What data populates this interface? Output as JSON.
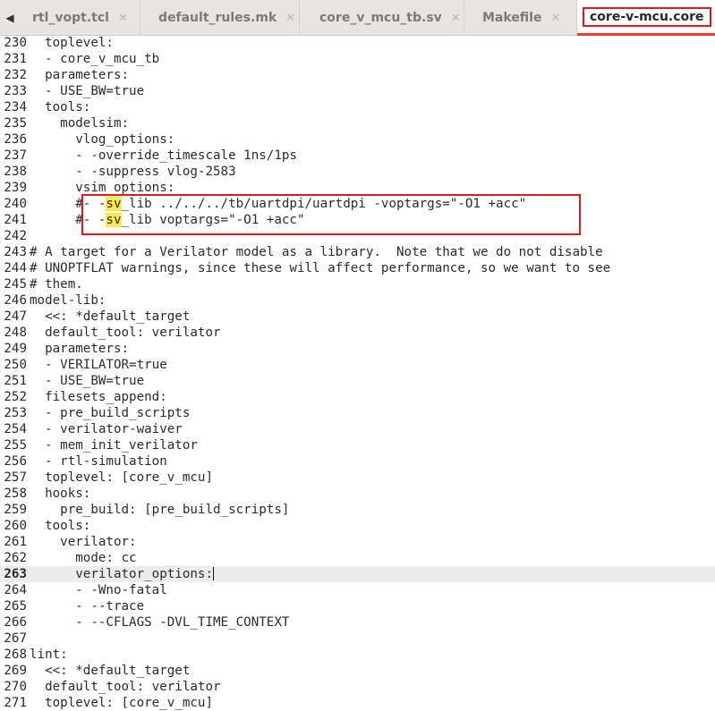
{
  "tabs": [
    {
      "label": "rtl_vopt.tcl",
      "active": false
    },
    {
      "label": "default_rules.mk",
      "active": false
    },
    {
      "label": "core_v_mcu_tb.sv",
      "active": false
    },
    {
      "label": "Makefile",
      "active": false
    },
    {
      "label": "core-v-mcu.core",
      "active": true
    }
  ],
  "icons": {
    "scroll_left": "triangle-left-icon",
    "close": "close-x-icon"
  },
  "glyphs": {
    "scroll_left": "◀",
    "close": "✕"
  },
  "colors": {
    "highlight": "#fce94f",
    "annotation": "#e0191b",
    "active_tab_underline": "#e8412c",
    "current_line": "#ececec"
  },
  "editor": {
    "current_line": 263,
    "lines": [
      {
        "num": "230",
        "pre": "  toplevel:"
      },
      {
        "num": "231",
        "pre": "  - core_v_mcu_tb"
      },
      {
        "num": "232",
        "pre": "  parameters:"
      },
      {
        "num": "233",
        "pre": "  - USE_BW=true"
      },
      {
        "num": "234",
        "pre": "  tools:"
      },
      {
        "num": "235",
        "pre": "    modelsim:"
      },
      {
        "num": "236",
        "pre": "      vlog_options:"
      },
      {
        "num": "237",
        "pre": "      - -override_timescale 1ns/1ps"
      },
      {
        "num": "238",
        "pre": "      - -suppress vlog-2583"
      },
      {
        "num": "239",
        "pre": "      vsim_options:"
      },
      {
        "num": "240",
        "pre": "      #- -",
        "hl": "sv",
        "post": "_lib ../../../tb/uartdpi/uartdpi -voptargs=\"-O1 +acc\""
      },
      {
        "num": "241",
        "pre": "      #- -",
        "hl": "sv",
        "post": "_lib voptargs=\"-O1 +acc\""
      },
      {
        "num": "242",
        "pre": ""
      },
      {
        "num": "243",
        "pre": "# A target for a Verilator model as a library.  Note that we do not disable"
      },
      {
        "num": "244",
        "pre": "# UNOPTFLAT warnings, since these will affect performance, so we want to see"
      },
      {
        "num": "245",
        "pre": "# them."
      },
      {
        "num": "246",
        "pre": "model-lib:"
      },
      {
        "num": "247",
        "pre": "  <<: *default_target"
      },
      {
        "num": "248",
        "pre": "  default_tool: verilator"
      },
      {
        "num": "249",
        "pre": "  parameters:"
      },
      {
        "num": "250",
        "pre": "  - VERILATOR=true"
      },
      {
        "num": "251",
        "pre": "  - USE_BW=true"
      },
      {
        "num": "252",
        "pre": "  filesets_append:"
      },
      {
        "num": "253",
        "pre": "  - pre_build_scripts"
      },
      {
        "num": "254",
        "pre": "  - verilator-waiver"
      },
      {
        "num": "255",
        "pre": "  - mem_init_verilator"
      },
      {
        "num": "256",
        "pre": "  - rtl-simulation"
      },
      {
        "num": "257",
        "pre": "  toplevel: [core_v_mcu]"
      },
      {
        "num": "258",
        "pre": "  hooks:"
      },
      {
        "num": "259",
        "pre": "    pre_build: [pre_build_scripts]"
      },
      {
        "num": "260",
        "pre": "  tools:"
      },
      {
        "num": "261",
        "pre": "    verilator:"
      },
      {
        "num": "262",
        "pre": "      mode: cc"
      },
      {
        "num": "263",
        "pre": "      verilator_options:"
      },
      {
        "num": "264",
        "pre": "      - -Wno-fatal"
      },
      {
        "num": "265",
        "pre": "      - --trace"
      },
      {
        "num": "266",
        "pre": "      - --CFLAGS -DVL_TIME_CONTEXT"
      },
      {
        "num": "267",
        "pre": ""
      },
      {
        "num": "268",
        "pre": "lint:"
      },
      {
        "num": "269",
        "pre": "  <<: *default_target"
      },
      {
        "num": "270",
        "pre": "  default_tool: verilator"
      },
      {
        "num": "271",
        "pre": "  toplevel: [core_v_mcu]"
      }
    ]
  }
}
